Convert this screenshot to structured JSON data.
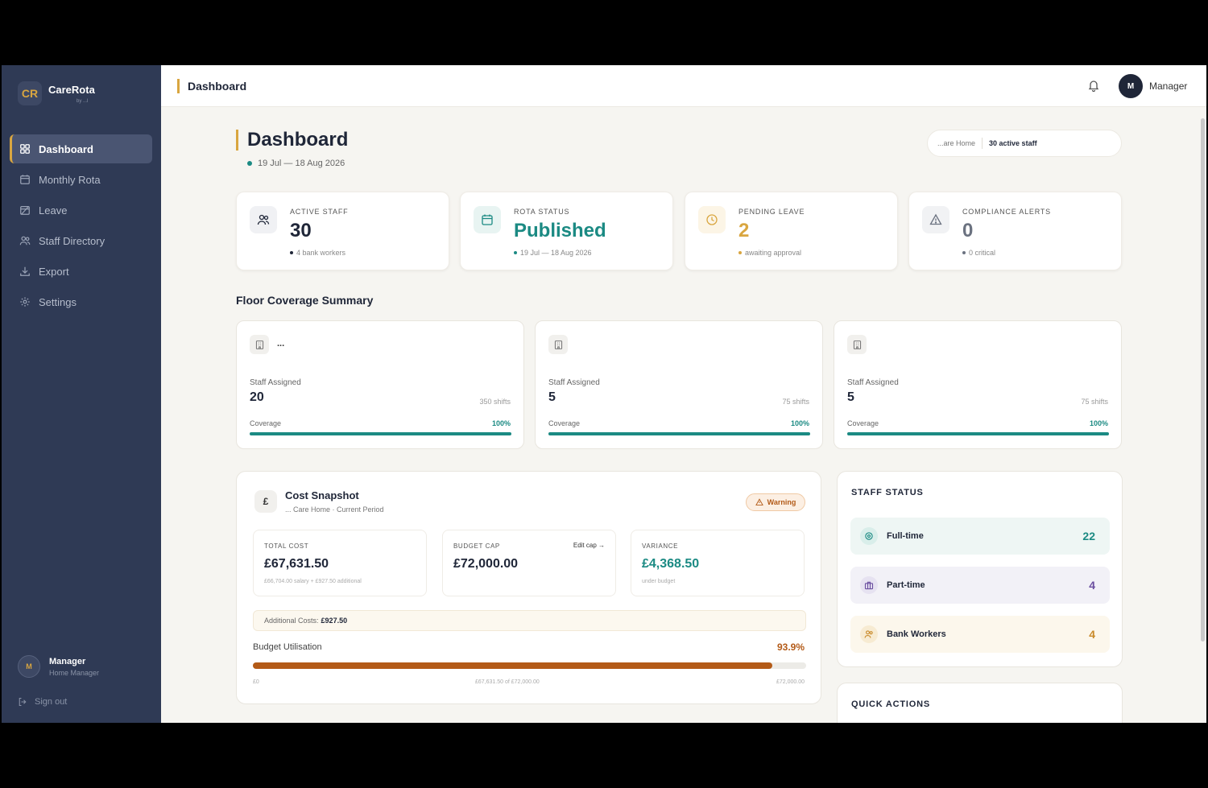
{
  "app": {
    "name": "CareRota",
    "logo": "CR",
    "sub": "by ...l"
  },
  "sidebar": {
    "items": [
      {
        "label": "Dashboard",
        "icon": "grid-icon"
      },
      {
        "label": "Monthly Rota",
        "icon": "calendar-icon"
      },
      {
        "label": "Leave",
        "icon": "calendar-off-icon"
      },
      {
        "label": "Staff Directory",
        "icon": "users-icon"
      },
      {
        "label": "Export",
        "icon": "download-icon"
      },
      {
        "label": "Settings",
        "icon": "gear-icon"
      }
    ],
    "user": {
      "initial": "M",
      "name": "Manager",
      "role": "Home Manager"
    },
    "signout": "Sign out"
  },
  "topbar": {
    "title": "Dashboard",
    "avatar": "M",
    "user": "Manager"
  },
  "page": {
    "title": "Dashboard",
    "date_range": "19 Jul — 18 Aug 2026",
    "home": "...are Home",
    "active_staff": "30 active staff"
  },
  "stats": [
    {
      "label": "ACTIVE STAFF",
      "value": "30",
      "sub": "4 bank workers",
      "color": "#1f2638",
      "icon": "users-icon"
    },
    {
      "label": "ROTA STATUS",
      "value": "Published",
      "sub": "19 Jul — 18 Aug 2026",
      "color": "#1b8a83",
      "icon": "calendar-icon"
    },
    {
      "label": "PENDING LEAVE",
      "value": "2",
      "sub": "awaiting approval",
      "color": "#d9a640",
      "icon": "clock-icon"
    },
    {
      "label": "COMPLIANCE ALERTS",
      "value": "0",
      "sub": "0 critical",
      "color": "#6b7280",
      "icon": "alert-triangle-icon"
    }
  ],
  "floor_section": {
    "title": "Floor Coverage Summary"
  },
  "floors": [
    {
      "name": "...",
      "staff_label": "Staff Assigned",
      "staff": "20",
      "shifts": "350 shifts",
      "coverage_label": "Coverage",
      "coverage": "100%",
      "coverage_value": 1.0
    },
    {
      "name": "",
      "staff_label": "Staff Assigned",
      "staff": "5",
      "shifts": "75 shifts",
      "coverage_label": "Coverage",
      "coverage": "100%",
      "coverage_value": 1.0
    },
    {
      "name": "",
      "staff_label": "Staff Assigned",
      "staff": "5",
      "shifts": "75 shifts",
      "coverage_label": "Coverage",
      "coverage": "100%",
      "coverage_value": 1.0
    }
  ],
  "cost": {
    "icon": "£",
    "title": "Cost Snapshot",
    "sub": "... Care Home · Current Period",
    "badge": "Warning",
    "total_label": "TOTAL COST",
    "total": "£67,631.50",
    "total_sub": "£66,704.00 salary + £927.50 additional",
    "cap_label": "BUDGET CAP",
    "cap": "£72,000.00",
    "edit": "Edit cap →",
    "var_label": "VARIANCE",
    "variance": "£4,368.50",
    "var_sub": "under budget",
    "additional_label": "Additional Costs:",
    "additional": "£927.50",
    "util_label": "Budget Utilisation",
    "util": "93.9%",
    "util_value": 0.939,
    "min": "£0",
    "mid": "£67,631.50 of £72,000.00",
    "max": "£72,000.00"
  },
  "staff_status": {
    "title": "STAFF STATUS",
    "rows": [
      {
        "label": "Full-time",
        "count": "22",
        "bg": "#eef6f4",
        "color": "#1b8a83",
        "icon": "target-icon"
      },
      {
        "label": "Part-time",
        "count": "4",
        "bg": "#f2f1f7",
        "color": "#6b4fa0",
        "icon": "briefcase-icon"
      },
      {
        "label": "Bank Workers",
        "count": "4",
        "bg": "#fcf7ec",
        "color": "#c98a2a",
        "icon": "users-icon"
      }
    ]
  },
  "quick_actions": {
    "title": "QUICK ACTIONS"
  }
}
